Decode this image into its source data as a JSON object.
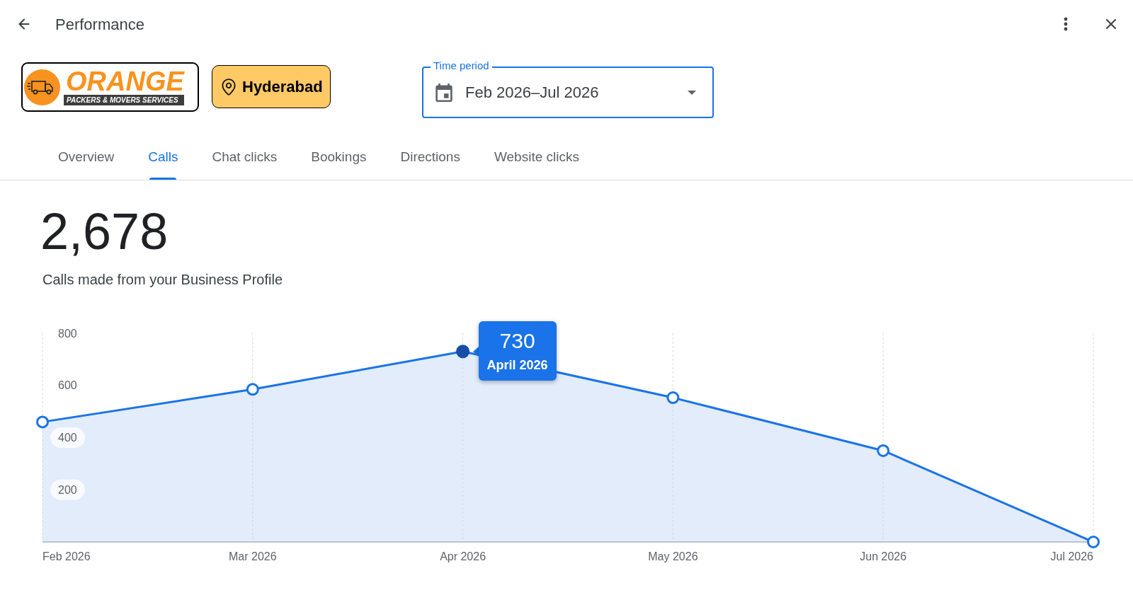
{
  "header": {
    "title": "Performance"
  },
  "business": {
    "logo": {
      "name": "ORANGE",
      "tagline": "PACKERS & MOVERS SERVICES"
    },
    "location": "Hyderabad"
  },
  "time_period": {
    "label": "Time period",
    "value": "Feb 2026–Jul 2026"
  },
  "tabs": [
    {
      "label": "Overview",
      "selected": false
    },
    {
      "label": "Calls",
      "selected": true
    },
    {
      "label": "Chat clicks",
      "selected": false
    },
    {
      "label": "Bookings",
      "selected": false
    },
    {
      "label": "Directions",
      "selected": false
    },
    {
      "label": "Website clicks",
      "selected": false
    }
  ],
  "metric": {
    "value": "2,678",
    "description": "Calls made from your Business Profile"
  },
  "chart": {
    "chart_data": {
      "type": "area",
      "categories": [
        "Feb 2026",
        "Mar 2026",
        "Apr 2026",
        "May 2026",
        "Jun 2026",
        "Jul 2026"
      ],
      "ylim": [
        0,
        800
      ],
      "yticks": [
        200,
        400,
        600,
        800
      ],
      "grid": true,
      "series": [
        {
          "color": "#1a73e8",
          "values": [
            460,
            585,
            730,
            553,
            350,
            0
          ]
        }
      ],
      "annotations": [
        {
          "x": "Apr 2026",
          "y": 730,
          "text": "730"
        }
      ]
    },
    "tooltip_caption": "April 2026"
  }
}
